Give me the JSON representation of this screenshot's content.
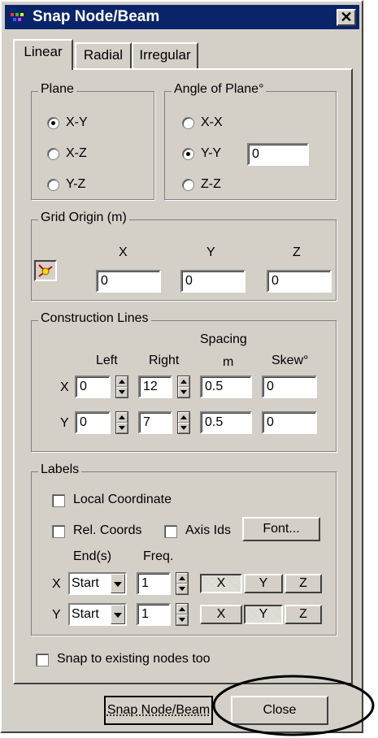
{
  "window": {
    "title": "Snap Node/Beam",
    "close_glyph": "✕"
  },
  "tabs": [
    {
      "label": "Linear",
      "active": true
    },
    {
      "label": "Radial",
      "active": false
    },
    {
      "label": "Irregular",
      "active": false
    }
  ],
  "plane": {
    "legend": "Plane",
    "options": [
      {
        "label": "X-Y",
        "selected": true
      },
      {
        "label": "X-Z",
        "selected": false
      },
      {
        "label": "Y-Z",
        "selected": false
      }
    ]
  },
  "angle_of_plane": {
    "legend": "Angle of Plane°",
    "options": [
      {
        "label": "X-X",
        "selected": false
      },
      {
        "label": "Y-Y",
        "selected": true
      },
      {
        "label": "Z-Z",
        "selected": false
      }
    ],
    "value": "0"
  },
  "grid_origin": {
    "legend": "Grid Origin (m)",
    "x_label": "X",
    "y_label": "Y",
    "z_label": "Z",
    "x": "0",
    "y": "0",
    "z": "0",
    "icon": "pick-node-icon"
  },
  "construction_lines": {
    "legend": "Construction Lines",
    "headers": {
      "left": "Left",
      "right": "Right",
      "spacing": "Spacing",
      "spacing_unit": "m",
      "skew": "Skew°"
    },
    "rows": [
      {
        "axis": "X",
        "left": "0",
        "right": "12",
        "spacing": "0.5",
        "skew": "0"
      },
      {
        "axis": "Y",
        "left": "0",
        "right": "7",
        "spacing": "0.5",
        "skew": "0"
      }
    ]
  },
  "labels": {
    "legend": "Labels",
    "local_coordinate": {
      "label": "Local Coordinate",
      "checked": false
    },
    "rel_coords": {
      "label": "Rel. Coords",
      "checked": false
    },
    "axis_ids": {
      "label": "Axis Ids",
      "checked": false
    },
    "font_button": "Font...",
    "ends_header": "End(s)",
    "freq_header": "Freq.",
    "rows": [
      {
        "axis": "X",
        "end": "Start",
        "freq": "1",
        "active_axis": "X"
      },
      {
        "axis": "Y",
        "end": "Start",
        "freq": "1",
        "active_axis": "Y"
      }
    ],
    "axis_buttons": [
      "X",
      "Y",
      "Z"
    ]
  },
  "snap_existing": {
    "label": "Snap to existing nodes too",
    "checked": false
  },
  "footer": {
    "snap_button": "Snap Node/Beam",
    "close_button": "Close"
  },
  "colors": {
    "titlebar": "#0a246a",
    "face": "#d4d0c8"
  }
}
